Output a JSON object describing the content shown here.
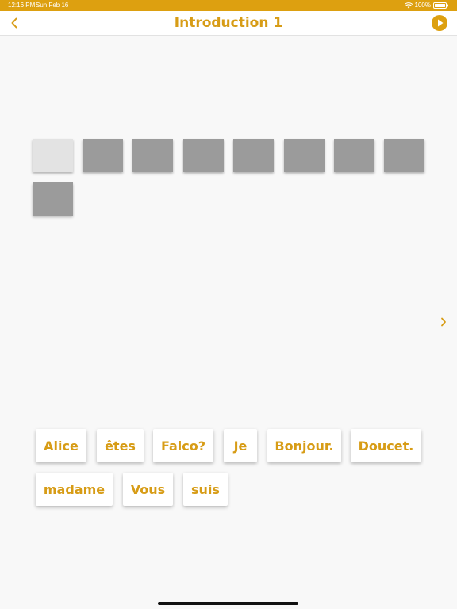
{
  "status_bar": {
    "time": "12:16 PM",
    "date": "Sun Feb 16",
    "battery": "100%"
  },
  "nav": {
    "title": "Introduction 1",
    "back_icon": "chevron-left-icon",
    "play_icon": "play-circle-icon"
  },
  "answer_slots": {
    "count": 9,
    "filled": [
      false,
      true,
      true,
      true,
      true,
      true,
      true,
      true,
      true
    ]
  },
  "next_icon": "chevron-right-icon",
  "word_bank": [
    "Alice",
    "êtes",
    "Falco?",
    "Je",
    "Bonjour.",
    "Doucet.",
    "madame",
    "Vous",
    "suis"
  ],
  "colors": {
    "accent": "#dda010",
    "text_accent": "#d79c16",
    "slot_filled": "#9b9b9b",
    "slot_empty": "#e3e3e3",
    "background": "#f8f8f8"
  }
}
